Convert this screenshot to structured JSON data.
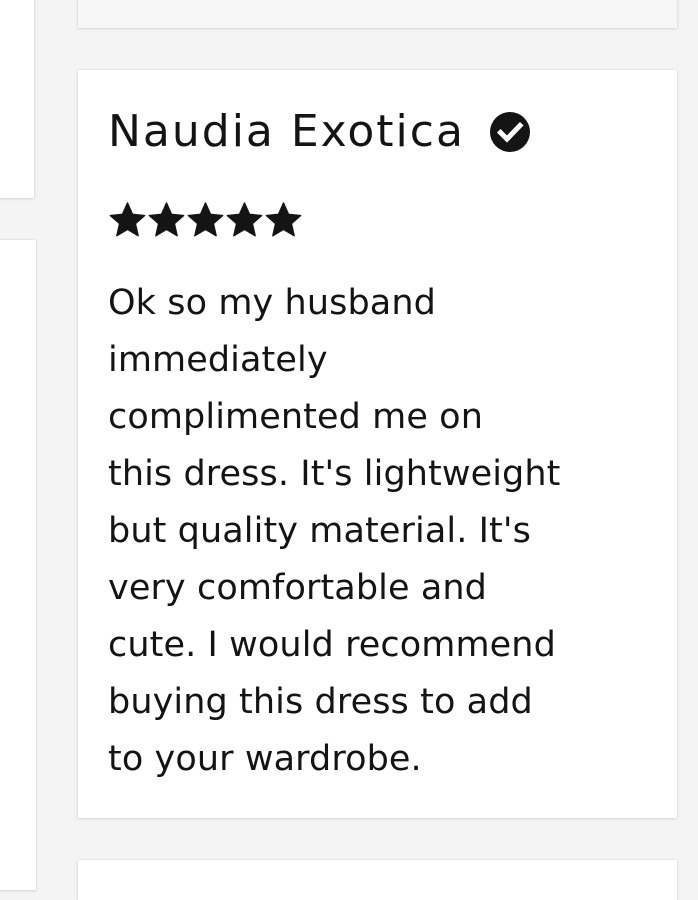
{
  "review": {
    "reviewer_name": "Naudia Exotica",
    "verified_icon": "check-circle-icon",
    "rating": 5,
    "rating_max": 5,
    "star_icon": "star-icon",
    "text_lines": [
      "Ok so my husband",
      "immediately",
      "complimented me on",
      "this dress. It's lightweight",
      "but quality material. It's",
      "very comfortable and",
      "cute. I would recommend",
      "buying this dress to add",
      "to your wardrobe."
    ]
  },
  "colors": {
    "background": "#f4f4f4",
    "card": "#ffffff",
    "text": "#141414"
  }
}
